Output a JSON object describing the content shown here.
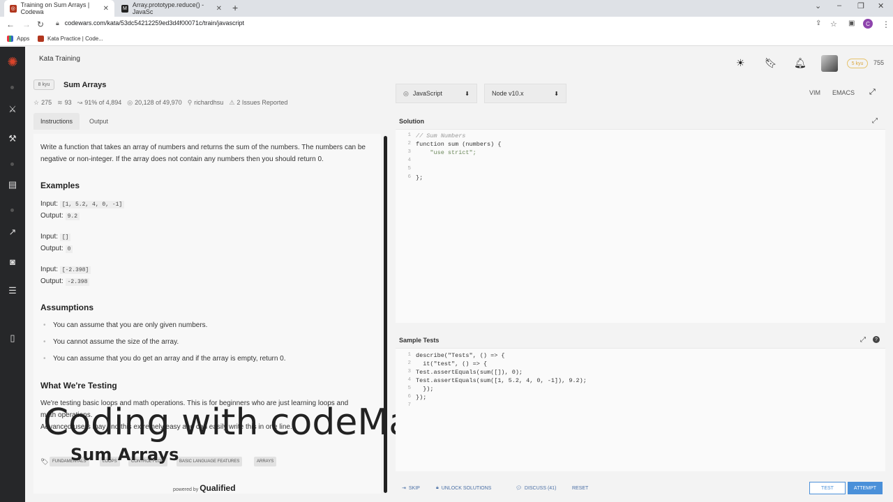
{
  "browser": {
    "tabs": [
      {
        "title": "Training on Sum Arrays | Codewa"
      },
      {
        "title": "Array.prototype.reduce() - JavaSc"
      }
    ],
    "url": "codewars.com/kata/53dc54212259ed3d4f00071c/train/javascript",
    "bookmarks": [
      "Apps",
      "Kata Practice | Code..."
    ]
  },
  "header": {
    "breadcrumb": "Kata Training",
    "rank": "5 kyu",
    "honor": "755"
  },
  "kata": {
    "kyu": "8 kyu",
    "title": "Sum Arrays",
    "stats": {
      "stars": "275",
      "collections": "93",
      "satisfaction": "91% of 4,894",
      "completions": "20,128 of 49,970",
      "author": "richardhsu",
      "issues": "2 Issues Reported"
    }
  },
  "left_tabs": [
    "Instructions",
    "Output"
  ],
  "instructions": {
    "intro": "Write a function that takes an array of numbers and returns the sum of the numbers. The numbers can be negative or non-integer. If the array does not contain any numbers then you should return 0.",
    "examples_heading": "Examples",
    "examples": [
      {
        "input_label": "Input:",
        "input": "[1, 5.2, 4, 0, -1]",
        "output_label": "Output:",
        "output": "9.2"
      },
      {
        "input_label": "Input:",
        "input": "[]",
        "output_label": "Output:",
        "output": "0"
      },
      {
        "input_label": "Input:",
        "input": "[-2.398]",
        "output_label": "Output:",
        "output": "-2.398"
      }
    ],
    "assumptions_heading": "Assumptions",
    "assumptions": [
      "You can assume that you are only given numbers.",
      "You cannot assume the size of the array.",
      "You can assume that you do get an array and if the array is empty, return 0."
    ],
    "testing_heading": "What We're Testing",
    "testing_line1": "We're testing basic loops and math operations. This is for beginners who are just learning loops and",
    "testing_line2": "math operations.",
    "testing_line3": "Advanced users may find this extremely easy and can easily write this in one line.",
    "tags": [
      "FUNDAMENTALS",
      "LOOPS",
      "CONTROL FLOW",
      "BASIC LANGUAGE FEATURES",
      "ARRAYS"
    ],
    "powered_by": "powered by",
    "powered_brand": "Qualified"
  },
  "overlay": {
    "title": "Coding with codeManS",
    "subtitle": "Sum Arrays"
  },
  "editor_controls": {
    "language": "JavaScript",
    "runtime": "Node v10.x",
    "modes": [
      "VIM",
      "EMACS"
    ]
  },
  "solution": {
    "heading": "Solution",
    "lines": [
      {
        "n": "1",
        "code": "// Sum Numbers"
      },
      {
        "n": "2",
        "code": "function sum (numbers) {"
      },
      {
        "n": "3",
        "code": "    \"use strict\";"
      },
      {
        "n": "4",
        "code": ""
      },
      {
        "n": "5",
        "code": ""
      },
      {
        "n": "6",
        "code": "};"
      }
    ]
  },
  "tests": {
    "heading": "Sample Tests",
    "lines": [
      {
        "n": "1",
        "code": "describe(\"Tests\", () => {"
      },
      {
        "n": "2",
        "code": "  it(\"test\", () => {"
      },
      {
        "n": "3",
        "code": "Test.assertEquals(sum([]), 0);"
      },
      {
        "n": "4",
        "code": "Test.assertEquals(sum([1, 5.2, 4, 0, -1]), 9.2);"
      },
      {
        "n": "5",
        "code": "  });"
      },
      {
        "n": "6",
        "code": "});"
      },
      {
        "n": "7",
        "code": ""
      }
    ]
  },
  "actions": {
    "skip": "SKIP",
    "unlock": "UNLOCK SOLUTIONS",
    "discuss": "DISCUSS (41)",
    "reset": "RESET",
    "test": "TEST",
    "attempt": "ATTEMPT"
  }
}
